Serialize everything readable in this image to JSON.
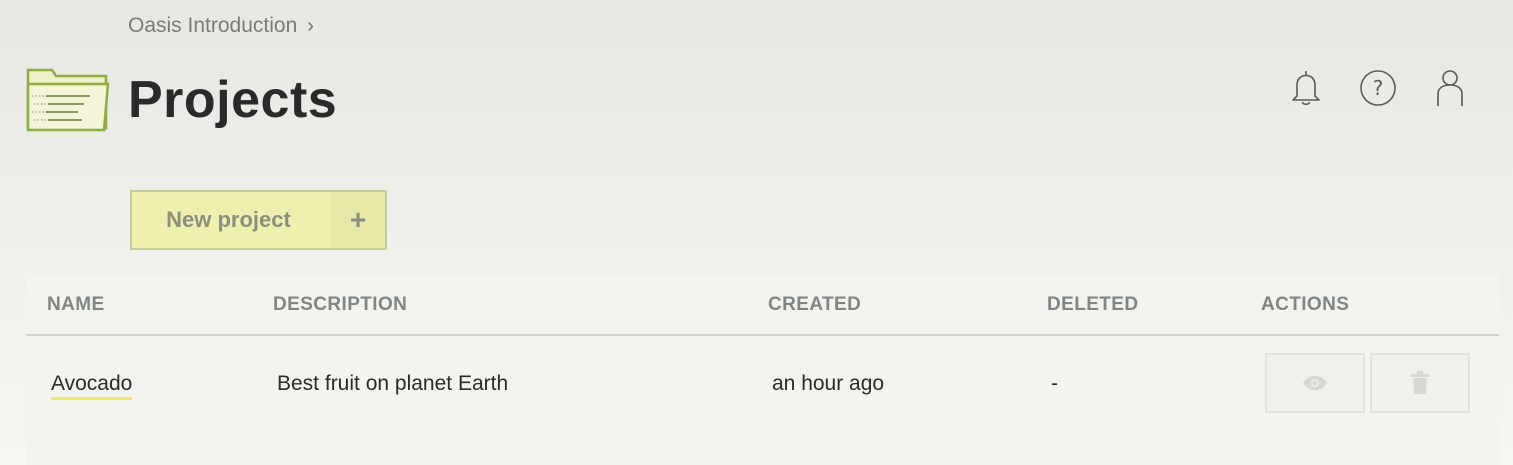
{
  "breadcrumb": {
    "item": "Oasis Introduction",
    "separator": "›"
  },
  "page": {
    "title": "Projects"
  },
  "header_icons": {
    "notifications": "bell-icon",
    "help": "help-icon",
    "account": "user-icon"
  },
  "toolbar": {
    "new_project_label": "New project",
    "new_project_icon": "+"
  },
  "table": {
    "columns": [
      "NAME",
      "DESCRIPTION",
      "CREATED",
      "DELETED",
      "ACTIONS"
    ],
    "rows": [
      {
        "name": "Avocado",
        "description": "Best fruit on planet Earth",
        "created": "an hour ago",
        "deleted": "-"
      }
    ]
  },
  "colors": {
    "accent": "#8fae3c",
    "button_bg": "#eef0ad",
    "link_underline": "#e7ea6d"
  }
}
